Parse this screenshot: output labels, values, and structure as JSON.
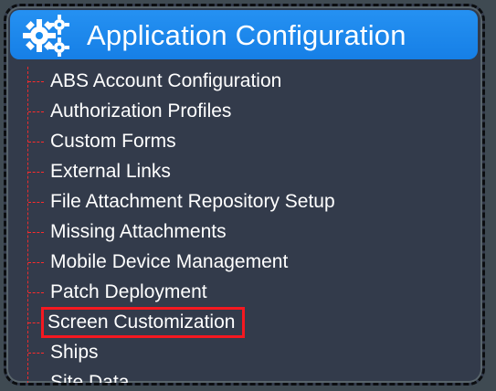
{
  "header": {
    "title": "Application Configuration",
    "icon": "gears-icon",
    "background": "#178bee"
  },
  "menu": {
    "items": [
      {
        "label": "ABS Account Configuration"
      },
      {
        "label": "Authorization Profiles"
      },
      {
        "label": "Custom Forms"
      },
      {
        "label": "External Links"
      },
      {
        "label": "File Attachment Repository Setup"
      },
      {
        "label": "Missing Attachments"
      },
      {
        "label": "Mobile Device Management"
      },
      {
        "label": "Patch Deployment"
      },
      {
        "label": "Screen Customization",
        "selected": true
      },
      {
        "label": "Ships"
      },
      {
        "label": "Site Data"
      }
    ]
  },
  "colors": {
    "panel": "#333b4b",
    "highlight": "#f51820",
    "text": "#ffffff"
  }
}
